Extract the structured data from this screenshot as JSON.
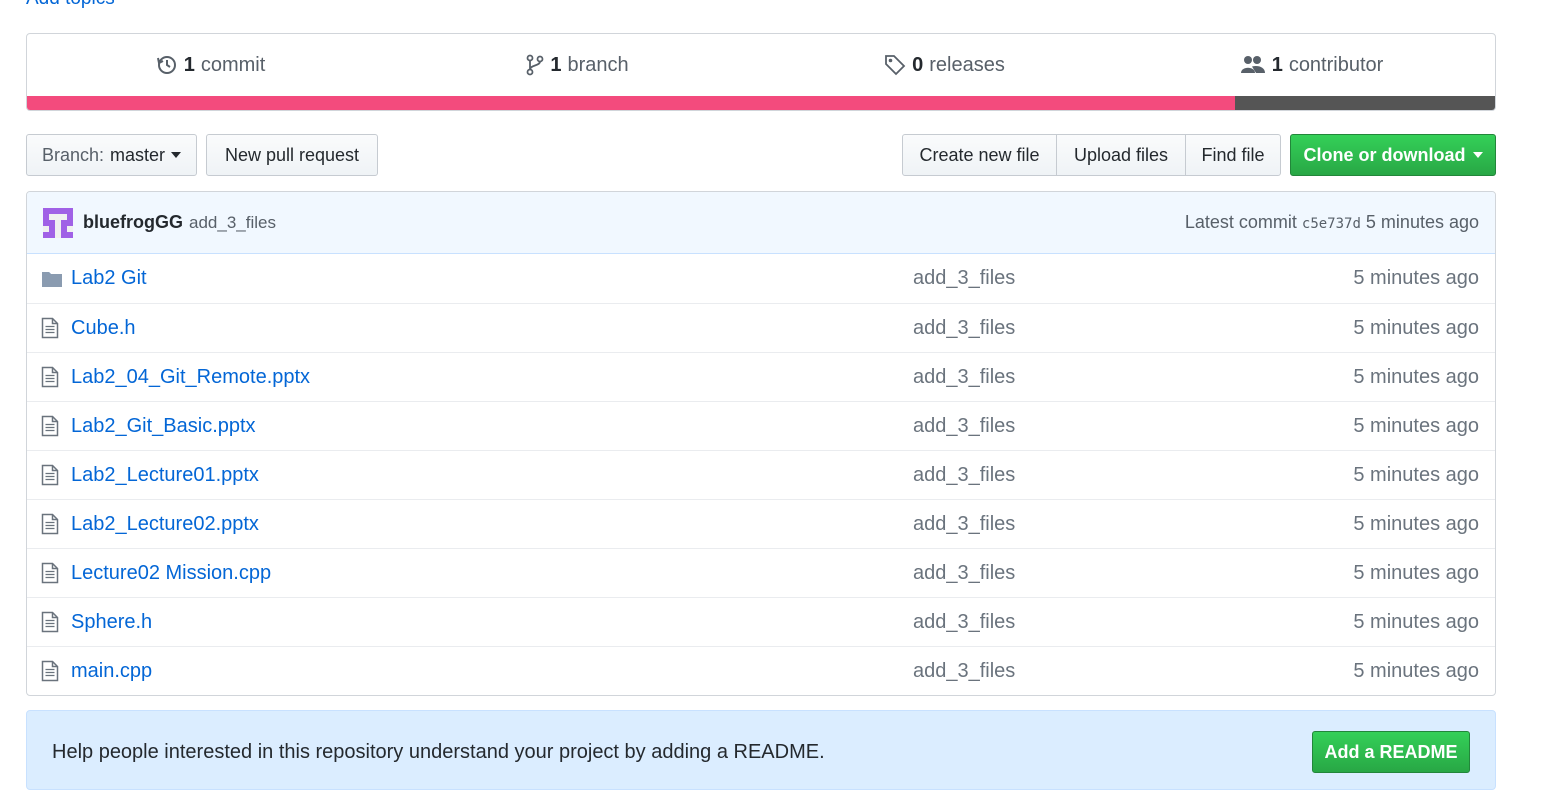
{
  "topics": {
    "add_label": "Add topics"
  },
  "summary": {
    "commits": {
      "count": "1",
      "label": "commit"
    },
    "branches": {
      "count": "1",
      "label": "branch"
    },
    "releases": {
      "count": "0",
      "label": "releases"
    },
    "contributors": {
      "count": "1",
      "label": "contributor"
    }
  },
  "languages": [
    {
      "color": "#f34b7d",
      "percent": 82.3
    },
    {
      "color": "#555555",
      "percent": 17.7
    }
  ],
  "file_nav": {
    "branch_prefix": "Branch:",
    "branch_name": "master",
    "new_pull_request": "New pull request",
    "create_new_file": "Create new file",
    "upload_files": "Upload files",
    "find_file": "Find file",
    "clone_or_download": "Clone or download"
  },
  "commit_tease": {
    "author": "bluefrogGG",
    "message": "add_3_files",
    "latest_label": "Latest commit",
    "sha": "c5e737d",
    "age": "5 minutes ago"
  },
  "files": [
    {
      "type": "folder",
      "name": "Lab2 Git",
      "message": "add_3_files",
      "age": "5 minutes ago"
    },
    {
      "type": "file",
      "name": "Cube.h",
      "message": "add_3_files",
      "age": "5 minutes ago"
    },
    {
      "type": "file",
      "name": "Lab2_04_Git_Remote.pptx",
      "message": "add_3_files",
      "age": "5 minutes ago"
    },
    {
      "type": "file",
      "name": "Lab2_Git_Basic.pptx",
      "message": "add_3_files",
      "age": "5 minutes ago"
    },
    {
      "type": "file",
      "name": "Lab2_Lecture01.pptx",
      "message": "add_3_files",
      "age": "5 minutes ago"
    },
    {
      "type": "file",
      "name": "Lab2_Lecture02.pptx",
      "message": "add_3_files",
      "age": "5 minutes ago"
    },
    {
      "type": "file",
      "name": "Lecture02 Mission.cpp",
      "message": "add_3_files",
      "age": "5 minutes ago"
    },
    {
      "type": "file",
      "name": "Sphere.h",
      "message": "add_3_files",
      "age": "5 minutes ago"
    },
    {
      "type": "file",
      "name": "main.cpp",
      "message": "add_3_files",
      "age": "5 minutes ago"
    }
  ],
  "readme_prompt": {
    "text": "Help people interested in this repository understand your project by adding a README.",
    "button": "Add a README"
  }
}
